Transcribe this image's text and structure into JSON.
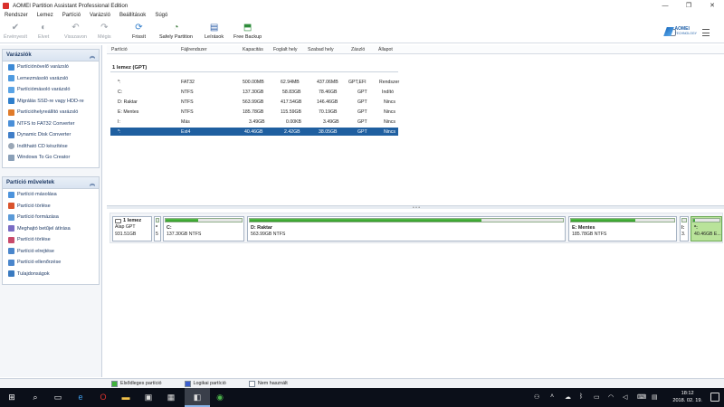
{
  "window": {
    "title": "AOMEI Partition Assistant Professional Edition",
    "controls": [
      "—",
      "❐",
      "✕"
    ]
  },
  "menu": [
    "Rendszer",
    "Lemez",
    "Partíció",
    "Varázsló",
    "Beállítások",
    "Súgó"
  ],
  "toolbar": {
    "buttons": [
      {
        "label": "Érvényesít",
        "icon": "check-icon",
        "disabled": true
      },
      {
        "label": "Elvet",
        "icon": "discard-icon",
        "disabled": true
      },
      {
        "label": "Visszavon",
        "icon": "undo-icon",
        "disabled": true
      },
      {
        "label": "Mégis",
        "icon": "redo-icon",
        "disabled": true
      },
      {
        "label": "Frissít",
        "icon": "refresh-icon",
        "disabled": false
      },
      {
        "label": "Safely Partition",
        "icon": "safely-partition-icon",
        "disabled": false
      },
      {
        "label": "Leírások",
        "icon": "tutorials-icon",
        "disabled": false
      },
      {
        "label": "Free Backup",
        "icon": "free-backup-icon",
        "disabled": false
      }
    ],
    "logo_line1": "AOMEI",
    "logo_line2": "TECHNOLOGY"
  },
  "sidebar": {
    "wizards": {
      "title": "Varázslók",
      "items": [
        "Partíciónövelő varázsló",
        "Lemezmásoló varázsló",
        "Partíciómásoló varázsló",
        "Migrálás SSD-re vagy HDD-re",
        "Partícióhelyreállító varázsló",
        "NTFS to FAT32 Converter",
        "Dynamic Disk Converter",
        "Indítható CD készítése",
        "Windows To Go Creator"
      ]
    },
    "operations": {
      "title": "Partíció műveletek",
      "items": [
        "Partíció másolása",
        "Partíció törlése",
        "Partíció formázása",
        "Meghajtó betűjel átírása",
        "Partíció törlése",
        "Partíció elrejtése",
        "Partíció ellenőrzése",
        "Tulajdonságok"
      ]
    }
  },
  "table": {
    "headers": [
      "Partíció",
      "Fájlrendszer",
      "Kapacitás",
      "Foglalt hely",
      "Szabad hely",
      "Zászló",
      "Állapot"
    ],
    "disk_title": "1 lemez (GPT)",
    "rows": [
      [
        "*:",
        "FAT32",
        "500.00MB",
        "62.94MB",
        "437.06MB",
        "GPT,EFI",
        "Rendszer"
      ],
      [
        "C:",
        "NTFS",
        "137.30GB",
        "58.83GB",
        "78.46GB",
        "GPT",
        "Indító"
      ],
      [
        "D: Raktar",
        "NTFS",
        "563.99GB",
        "417.54GB",
        "146.46GB",
        "GPT",
        "Nincs"
      ],
      [
        "E: Mentes",
        "NTFS",
        "185.78GB",
        "115.59GB",
        "70.19GB",
        "GPT",
        "Nincs"
      ],
      [
        "I:",
        "Más",
        "3.49GB",
        "0.00KB",
        "3.49GB",
        "GPT",
        "Nincs"
      ],
      [
        "*:",
        "Ext4",
        "40.46GB",
        "2.42GB",
        "38.05GB",
        "GPT",
        "Nincs"
      ]
    ],
    "selected_row": 5
  },
  "diskmap": {
    "disk": {
      "name": "1 lemez",
      "type": "Alap GPT",
      "size": "931.51GB"
    },
    "partitions": [
      {
        "name": "*",
        "info": "5",
        "used_frac": 0.13
      },
      {
        "name": "C:",
        "info": "137.30GB NTFS",
        "used_frac": 0.43
      },
      {
        "name": "D: Raktar",
        "info": "563.99GB NTFS",
        "used_frac": 0.74
      },
      {
        "name": "E: Mentes",
        "info": "185.78GB NTFS",
        "used_frac": 0.62
      },
      {
        "name": "I:",
        "info": "3.",
        "used_frac": 0.0
      },
      {
        "name": "*:",
        "info": "40.46GB E...",
        "used_frac": 0.06
      }
    ]
  },
  "legend": [
    {
      "label": "Elsődleges partíció",
      "color": "#3fb23a"
    },
    {
      "label": "Logikai partíció",
      "color": "#3c5fd0"
    },
    {
      "label": "Nem használt",
      "color": "#ffffff"
    }
  ],
  "taskbar": {
    "time": "18:12",
    "date": "2018. 02. 19.",
    "apps": [
      "start-icon",
      "search-icon",
      "task-view-icon",
      "edge-icon",
      "opera-icon",
      "explorer-icon",
      "store-icon",
      "pictures-icon",
      "partition-assistant-icon",
      "chrome-icon"
    ]
  }
}
